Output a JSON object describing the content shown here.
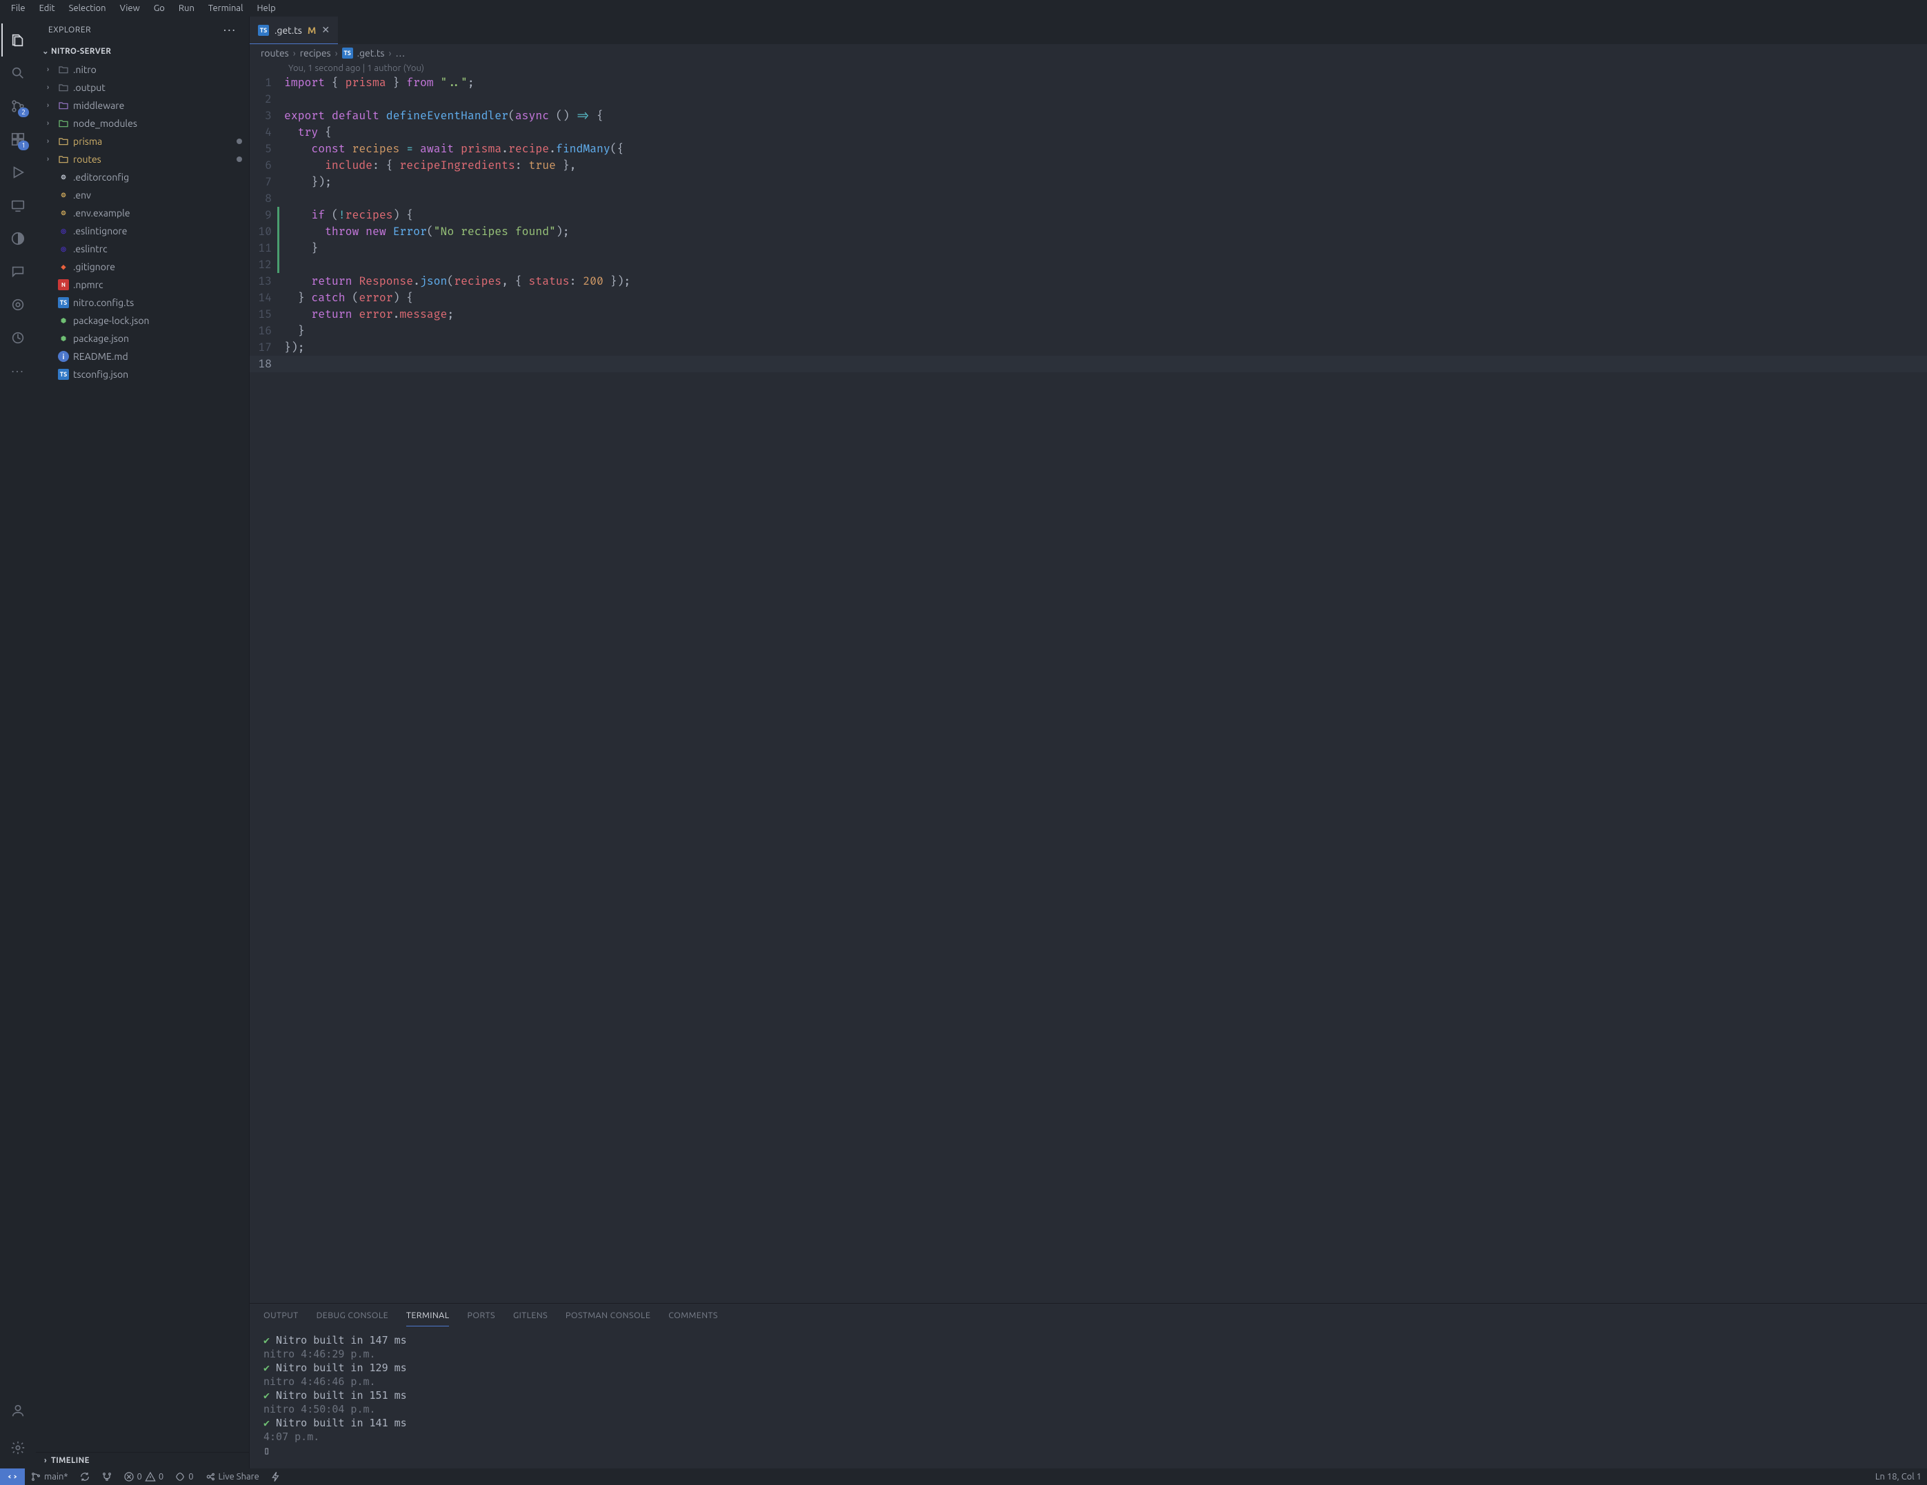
{
  "menubar": [
    "File",
    "Edit",
    "Selection",
    "View",
    "Go",
    "Run",
    "Terminal",
    "Help"
  ],
  "sidebar": {
    "header": "EXPLORER",
    "section": "NITRO-SERVER",
    "timeline": "TIMELINE",
    "tree": [
      {
        "type": "folder",
        "name": ".nitro",
        "icon": "folder"
      },
      {
        "type": "folder",
        "name": ".output",
        "icon": "folder"
      },
      {
        "type": "folder",
        "name": "middleware",
        "icon": "folder purple"
      },
      {
        "type": "folder",
        "name": "node_modules",
        "icon": "folder green"
      },
      {
        "type": "folder",
        "name": "prisma",
        "icon": "folder yellow",
        "accent": true,
        "dirty": true
      },
      {
        "type": "folder",
        "name": "routes",
        "icon": "folder yellow",
        "accent": true,
        "dirty": true
      },
      {
        "type": "file",
        "name": ".editorconfig",
        "icon": "dotfile",
        "glyph": "⚙"
      },
      {
        "type": "file",
        "name": ".env",
        "icon": "env",
        "glyph": "⚙"
      },
      {
        "type": "file",
        "name": ".env.example",
        "icon": "env",
        "glyph": "⚙"
      },
      {
        "type": "file",
        "name": ".eslintignore",
        "icon": "eslint",
        "glyph": "◎"
      },
      {
        "type": "file",
        "name": ".eslintrc",
        "icon": "eslint",
        "glyph": "◎"
      },
      {
        "type": "file",
        "name": ".gitignore",
        "icon": "git",
        "glyph": "◆"
      },
      {
        "type": "file",
        "name": ".npmrc",
        "icon": "npm",
        "glyph": "N"
      },
      {
        "type": "file",
        "name": "nitro.config.ts",
        "icon": "ts",
        "glyph": "TS"
      },
      {
        "type": "file",
        "name": "package-lock.json",
        "icon": "node",
        "glyph": "⬢"
      },
      {
        "type": "file",
        "name": "package.json",
        "icon": "node",
        "glyph": "⬢"
      },
      {
        "type": "file",
        "name": "README.md",
        "icon": "info",
        "glyph": "i"
      },
      {
        "type": "file",
        "name": "tsconfig.json",
        "icon": "tsconfig",
        "glyph": "TS"
      }
    ]
  },
  "activity": {
    "scm_badge": "2",
    "ext_badge": "1"
  },
  "tab": {
    "filename": ".get.ts",
    "modifier": "M"
  },
  "breadcrumbs": [
    "routes",
    "recipes",
    ".get.ts",
    "…"
  ],
  "blame": "You, 1 second ago | 1 author (You)",
  "code": [
    {
      "n": 1,
      "html": "<span class='tok-kw'>import</span><span class='tok-pl'> { </span><span class='tok-id'>prisma</span><span class='tok-pl'> } </span><span class='tok-kw'>from</span><span class='tok-pl'> </span><span class='tok-str'>\"..\"</span><span class='tok-pl'>;</span>"
    },
    {
      "n": 2,
      "html": ""
    },
    {
      "n": 3,
      "html": "<span class='tok-kw'>export</span><span class='tok-pl'> </span><span class='tok-kw'>default</span><span class='tok-pl'> </span><span class='tok-fn'>defineEventHandler</span><span class='tok-pl'>(</span><span class='tok-kw'>async</span><span class='tok-pl'> () </span><span class='tok-op'>=&gt;</span><span class='tok-pl'> {</span>"
    },
    {
      "n": 4,
      "html": "<span class='tok-pl'>  </span><span class='tok-kw'>try</span><span class='tok-pl'> {</span>"
    },
    {
      "n": 5,
      "html": "<span class='tok-pl'>    </span><span class='tok-kw'>const</span><span class='tok-pl'> </span><span class='tok-at'>recipes</span><span class='tok-pl'> </span><span class='tok-op'>=</span><span class='tok-pl'> </span><span class='tok-kw'>await</span><span class='tok-pl'> </span><span class='tok-id'>prisma</span><span class='tok-pl'>.</span><span class='tok-id'>recipe</span><span class='tok-pl'>.</span><span class='tok-fn'>findMany</span><span class='tok-pl'>({</span>"
    },
    {
      "n": 6,
      "html": "<span class='tok-pl'>      </span><span class='tok-id'>include</span><span class='tok-pl'>: { </span><span class='tok-id'>recipeIngredients</span><span class='tok-pl'>: </span><span class='tok-at'>true</span><span class='tok-pl'> },</span>"
    },
    {
      "n": 7,
      "html": "<span class='tok-pl'>    });</span>"
    },
    {
      "n": 8,
      "html": ""
    },
    {
      "n": 9,
      "diff": true,
      "html": "<span class='tok-pl'>    </span><span class='tok-kw'>if</span><span class='tok-pl'> (</span><span class='tok-op'>!</span><span class='tok-id'>recipes</span><span class='tok-pl'>) {</span>"
    },
    {
      "n": 10,
      "diff": true,
      "html": "<span class='tok-pl'>      </span><span class='tok-kw'>throw</span><span class='tok-pl'> </span><span class='tok-kw'>new</span><span class='tok-pl'> </span><span class='tok-fn'>Error</span><span class='tok-pl'>(</span><span class='tok-str'>\"No recipes found\"</span><span class='tok-pl'>);</span>"
    },
    {
      "n": 11,
      "diff": true,
      "html": "<span class='tok-pl'>    }</span>"
    },
    {
      "n": 12,
      "diff": true,
      "html": ""
    },
    {
      "n": 13,
      "html": "<span class='tok-pl'>    </span><span class='tok-kw'>return</span><span class='tok-pl'> </span><span class='tok-id'>Response</span><span class='tok-pl'>.</span><span class='tok-fn'>json</span><span class='tok-pl'>(</span><span class='tok-id'>recipes</span><span class='tok-pl'>, { </span><span class='tok-id'>status</span><span class='tok-pl'>: </span><span class='tok-num'>200</span><span class='tok-pl'> });</span>"
    },
    {
      "n": 14,
      "html": "<span class='tok-pl'>  } </span><span class='tok-kw'>catch</span><span class='tok-pl'> (</span><span class='tok-id'>error</span><span class='tok-pl'>) {</span>"
    },
    {
      "n": 15,
      "html": "<span class='tok-pl'>    </span><span class='tok-kw'>return</span><span class='tok-pl'> </span><span class='tok-id'>error</span><span class='tok-pl'>.</span><span class='tok-id'>message</span><span class='tok-pl'>;</span>"
    },
    {
      "n": 16,
      "html": "<span class='tok-pl'>  }</span>"
    },
    {
      "n": 17,
      "html": "<span class='tok-pl'>});</span>"
    },
    {
      "n": 18,
      "current": true,
      "html": ""
    }
  ],
  "panel": {
    "tabs": [
      "OUTPUT",
      "DEBUG CONSOLE",
      "TERMINAL",
      "PORTS",
      "GITLENS",
      "POSTMAN CONSOLE",
      "COMMENTS"
    ],
    "active": "TERMINAL",
    "lines": [
      {
        "cls": "",
        "text": "✔ Nitro built in 147 ms",
        "ok": true
      },
      {
        "cls": "dim",
        "text": "nitro 4:46:29 p.m."
      },
      {
        "cls": "",
        "text": "✔ Nitro built in 129 ms",
        "ok": true
      },
      {
        "cls": "dim",
        "text": "nitro 4:46:46 p.m."
      },
      {
        "cls": "",
        "text": "✔ Nitro built in 151 ms",
        "ok": true
      },
      {
        "cls": "dim",
        "text": "nitro 4:50:04 p.m."
      },
      {
        "cls": "",
        "text": "✔ Nitro built in 141 ms",
        "ok": true
      },
      {
        "cls": "dim",
        "text": "4:07 p.m."
      },
      {
        "cls": "",
        "text": "▯"
      }
    ]
  },
  "status": {
    "branch": "main*",
    "errors": "0",
    "warnings": "0",
    "radio": "0",
    "liveshare": "Live Share",
    "position": "Ln 18, Col 1"
  }
}
